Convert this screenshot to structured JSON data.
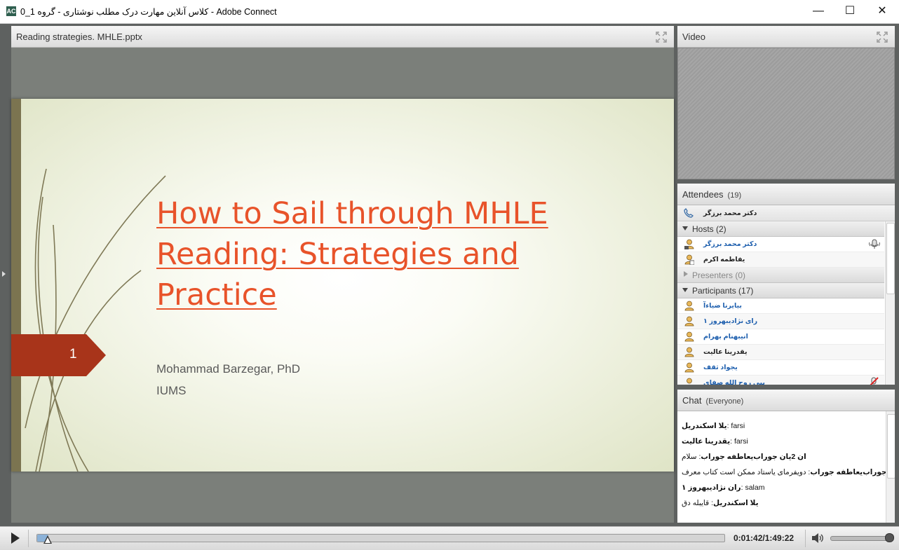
{
  "window": {
    "title": "کلاس آنلاین مهارت درک مطلب نوشتاری - گروه 1_0 - Adobe Connect",
    "app_icon": "adobe-connect-icon",
    "controls": {
      "minimize": "—",
      "maximize": "☐",
      "close": "✕"
    }
  },
  "share_pod": {
    "title": "Reading strategies. MHLE.pptx",
    "slide": {
      "title": "How to Sail through MHLE Reading: Strategies and Practice",
      "number": "1",
      "author": "Mohammad Barzegar, PhD",
      "institution": "IUMS",
      "accent_color": "#e8532a",
      "tag_color": "#a8341a"
    }
  },
  "video_pod": {
    "title": "Video"
  },
  "attendees_pod": {
    "title": "Attendees",
    "count": "(19)",
    "speaking_user": "دکتر محمد برزگر",
    "hosts": {
      "label": "Hosts (2)",
      "items": [
        {
          "name": "دکتر محمد برزگر",
          "link": true
        },
        {
          "name": "یفاطمه اکرم",
          "link": false
        }
      ]
    },
    "presenters": {
      "label": "Presenters (0)"
    },
    "participants": {
      "label": "Participants (17)",
      "items": [
        {
          "name": "بیایرنا ضیاءآ",
          "link": true
        },
        {
          "name": "رای نژادیبهروز ۱",
          "link": true
        },
        {
          "name": "انیبهنام بهرام",
          "link": true
        },
        {
          "name": "یقدرینا عالیت",
          "link": false
        },
        {
          "name": "یجواد ثقف",
          "link": true
        },
        {
          "name": "یبی روح الله صفای",
          "link": true
        }
      ]
    }
  },
  "chat_pod": {
    "title": "Chat",
    "scope": "(Everyone)",
    "messages": [
      {
        "sender": "یلا اسکندریل",
        "text": "farsi"
      },
      {
        "sender": "یقدرینا عالیت",
        "text": "farsi"
      },
      {
        "sender": "ان 2یان جوراب‌یعاطفه جوراب",
        "text": "سلام"
      },
      {
        "sender": "ان 2یان جوراب‌یعاطفه جوراب",
        "text": "دویفرمای یاستاد ممکن است کتاب معرف"
      },
      {
        "sender": "ران نژادیبهروز ۱",
        "text": "salam"
      },
      {
        "sender": "یلا اسکندریل",
        "text": "قایبله دق"
      }
    ]
  },
  "playback": {
    "time": "0:01:42/1:49:22",
    "progress": 0.016,
    "volume": 1.0
  }
}
